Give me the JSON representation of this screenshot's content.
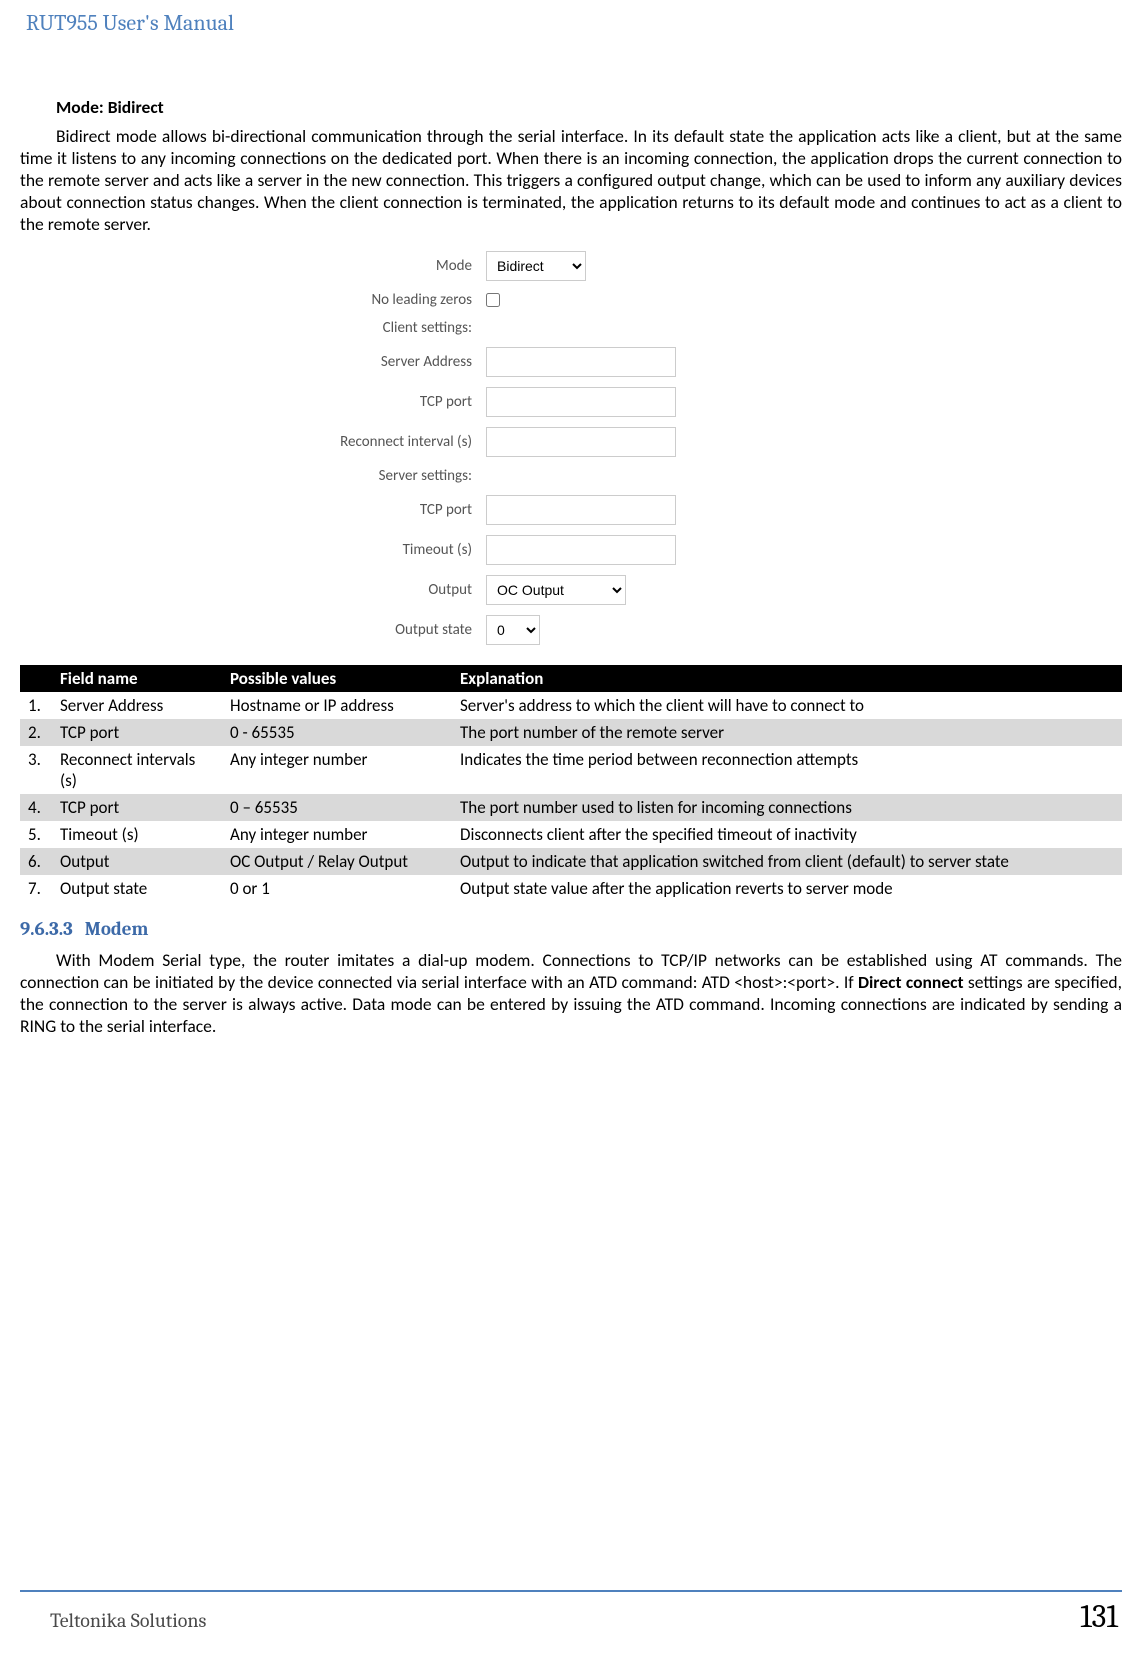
{
  "header": {
    "title": "RUT955 User's Manual"
  },
  "mode_section": {
    "title": "Mode: Bidirect",
    "paragraph": "Bidirect mode allows bi-directional communication through the serial interface. In its default state the application acts like a client, but at the same time it listens to any incoming connections on the dedicated port. When there is an incoming connection, the application drops the current connection to the remote server and acts like a server in the new connection. This triggers a configured output change, which can be used to inform any auxiliary devices about connection status changes. When the client connection is terminated, the application returns to its default mode and continues to act as a client to the remote server."
  },
  "form": {
    "mode_label": "Mode",
    "mode_value": "Bidirect",
    "no_leading_zeros_label": "No leading zeros",
    "client_settings_label": "Client settings:",
    "server_address_label": "Server Address",
    "tcp_port_label": "TCP port",
    "reconnect_interval_label": "Reconnect interval (s)",
    "server_settings_label": "Server settings:",
    "tcp_port2_label": "TCP port",
    "timeout_label": "Timeout (s)",
    "output_label": "Output",
    "output_value": "OC Output",
    "output_state_label": "Output state",
    "output_state_value": "0"
  },
  "table": {
    "headers": {
      "num": "",
      "field": "Field name",
      "values": "Possible values",
      "explanation": "Explanation"
    },
    "rows": [
      {
        "num": "1.",
        "field": "Server Address",
        "values": "Hostname or IP address",
        "explanation": "Server's address to which the client will have to connect to"
      },
      {
        "num": "2.",
        "field": "TCP port",
        "values": "0 - 65535",
        "explanation": "The port number of the remote server"
      },
      {
        "num": "3.",
        "field": "Reconnect intervals (s)",
        "values": "Any integer number",
        "explanation": "Indicates the time period between reconnection attempts"
      },
      {
        "num": "4.",
        "field": "TCP port",
        "values": "0 – 65535",
        "explanation": "The port number used to listen for incoming connections"
      },
      {
        "num": "5.",
        "field": "Timeout (s)",
        "values": "Any integer number",
        "explanation": "Disconnects client after the specified timeout of inactivity"
      },
      {
        "num": "6.",
        "field": "Output",
        "values": "OC Output / Relay Output",
        "explanation": "Output  to indicate that application switched from client (default) to server state"
      },
      {
        "num": "7.",
        "field": "Output state",
        "values": "0 or 1",
        "explanation": "Output state value after the application reverts to server mode"
      }
    ]
  },
  "modem_section": {
    "num": "9.6.3.3",
    "title": "Modem",
    "para_before_bold": "With Modem Serial type, the router imitates a dial-up modem. Connections to TCP/IP networks can be established using AT commands. The connection can be initiated by the device connected via serial interface with an ATD command: ATD <host>:<port>. If ",
    "bold": "Direct connect",
    "para_after_bold": " settings are specified, the connection to the server is always active. Data mode can be entered by issuing the ATD command. Incoming connections are indicated by sending a RING to the serial interface."
  },
  "footer": {
    "left": "Teltonika Solutions",
    "right": "131"
  }
}
